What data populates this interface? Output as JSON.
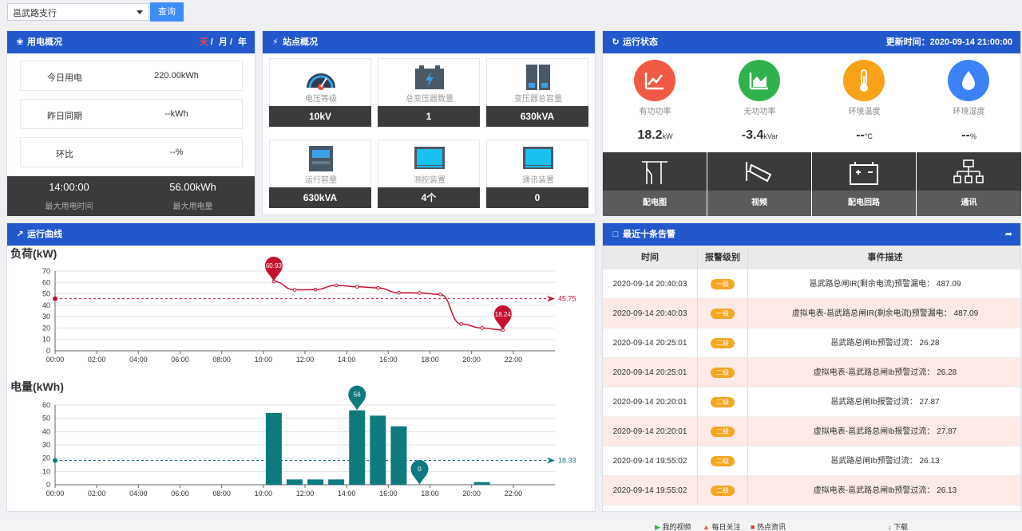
{
  "topbar": {
    "branch": "邕武路支行",
    "query_label": "查询"
  },
  "usage": {
    "title": "用电概况",
    "ranges": [
      "天",
      "月",
      "年"
    ],
    "rows": [
      {
        "label": "今日用电",
        "value": "220.00kWh"
      },
      {
        "label": "昨日同期",
        "value": "--kWh"
      },
      {
        "label": "环比",
        "value": "--%"
      }
    ],
    "max_time": "14:00:00",
    "max_time_label": "最大用电时间",
    "max_energy": "56.00kWh",
    "max_energy_label": "最大用电量"
  },
  "site": {
    "title": "站点概况",
    "cards": [
      {
        "label": "电压等级",
        "value": "10kV"
      },
      {
        "label": "总变压器数量",
        "value": "1"
      },
      {
        "label": "变压器总容量",
        "value": "630kVA"
      },
      {
        "label": "运行容量",
        "value": "630kVA"
      },
      {
        "label": "测控装置",
        "value": "4个"
      },
      {
        "label": "通讯装置",
        "value": "0"
      }
    ]
  },
  "status": {
    "title": "运行状态",
    "updated": "更新时间：2020-09-14 21:00:00",
    "gauges": [
      {
        "label": "有功功率",
        "value": "18.2",
        "unit": "kW",
        "color": "#f05a45"
      },
      {
        "label": "无功功率",
        "value": "-3.4",
        "unit": "kVar",
        "color": "#2eb34c"
      },
      {
        "label": "环境温度",
        "value": "--",
        "unit": "°C",
        "color": "#f7a218"
      },
      {
        "label": "环境湿度",
        "value": "--",
        "unit": "%",
        "color": "#3b82f6"
      }
    ],
    "tiles": [
      "配电图",
      "视频",
      "配电回路",
      "通讯"
    ]
  },
  "curve": {
    "title": "运行曲线",
    "load_title": "负荷(kW)",
    "energy_title": "电量(kWh)"
  },
  "chart_data": [
    {
      "type": "line",
      "title": "负荷(kW)",
      "x_ticks": [
        "00:00",
        "02:00",
        "04:00",
        "06:00",
        "08:00",
        "10:00",
        "12:00",
        "14:00",
        "16:00",
        "18:00",
        "20:00",
        "22:00"
      ],
      "x": [
        10,
        11,
        12,
        13,
        14,
        15,
        16,
        17,
        18,
        19,
        20,
        21
      ],
      "values": [
        60.93,
        53.5,
        53.8,
        57.5,
        56.2,
        55.2,
        51.0,
        50.8,
        49.5,
        23.5,
        20.0,
        18.24
      ],
      "ylim": [
        0,
        70
      ],
      "y_ticks": [
        0,
        10,
        20,
        30,
        40,
        50,
        60,
        70
      ],
      "average": 45.75,
      "max_label": "60.93",
      "min_label": "18.24",
      "avg_label": "45.75",
      "color": "#c8102e"
    },
    {
      "type": "bar",
      "title": "电量(kWh)",
      "x_ticks": [
        "00:00",
        "02:00",
        "04:00",
        "06:00",
        "08:00",
        "10:00",
        "12:00",
        "14:00",
        "16:00",
        "18:00",
        "20:00",
        "22:00"
      ],
      "x": [
        10,
        11,
        12,
        13,
        14,
        15,
        16,
        17,
        18,
        19,
        20,
        21
      ],
      "values": [
        54,
        4,
        4,
        4,
        56,
        52,
        44,
        0,
        0,
        0,
        2,
        0
      ],
      "ylim": [
        0,
        60
      ],
      "y_ticks": [
        0,
        10,
        20,
        30,
        40,
        50,
        60
      ],
      "average": 18.33,
      "max_label": "56",
      "min_label": "0",
      "avg_label": "18.33",
      "color": "#0e7a7e"
    }
  ],
  "alarms": {
    "title": "最近十条告警",
    "headers": [
      "时间",
      "报警级别",
      "事件描述"
    ],
    "rows": [
      {
        "time": "2020-09-14 20:40:03",
        "level": "一级",
        "desc": "邕武路总闸IR(剩余电流)预警漏电： 487.09"
      },
      {
        "time": "2020-09-14 20:40:03",
        "level": "一级",
        "desc": "虚拟电表-邕武路总闸IR(剩余电流)预警漏电： 487.09"
      },
      {
        "time": "2020-09-14 20:25:01",
        "level": "二级",
        "desc": "邕武路总闸Ib预警过流： 26.28"
      },
      {
        "time": "2020-09-14 20:25:01",
        "level": "二级",
        "desc": "虚拟电表-邕武路总闸Ib预警过流： 26.28"
      },
      {
        "time": "2020-09-14 20:20:01",
        "level": "二级",
        "desc": "邕武路总闸Ib报警过流： 27.87"
      },
      {
        "time": "2020-09-14 20:20:01",
        "level": "二级",
        "desc": "虚拟电表-邕武路总闸Ib报警过流： 27.87"
      },
      {
        "time": "2020-09-14 19:55:02",
        "level": "二级",
        "desc": "邕武路总闸Ib预警过流： 26.13"
      },
      {
        "time": "2020-09-14 19:55:02",
        "level": "二级",
        "desc": "虚拟电表-邕武路总闸Ib预警过流： 26.13"
      }
    ]
  },
  "taskbar": {
    "items": [
      "我的视频",
      "每日关注",
      "热点资讯",
      "下载"
    ]
  }
}
